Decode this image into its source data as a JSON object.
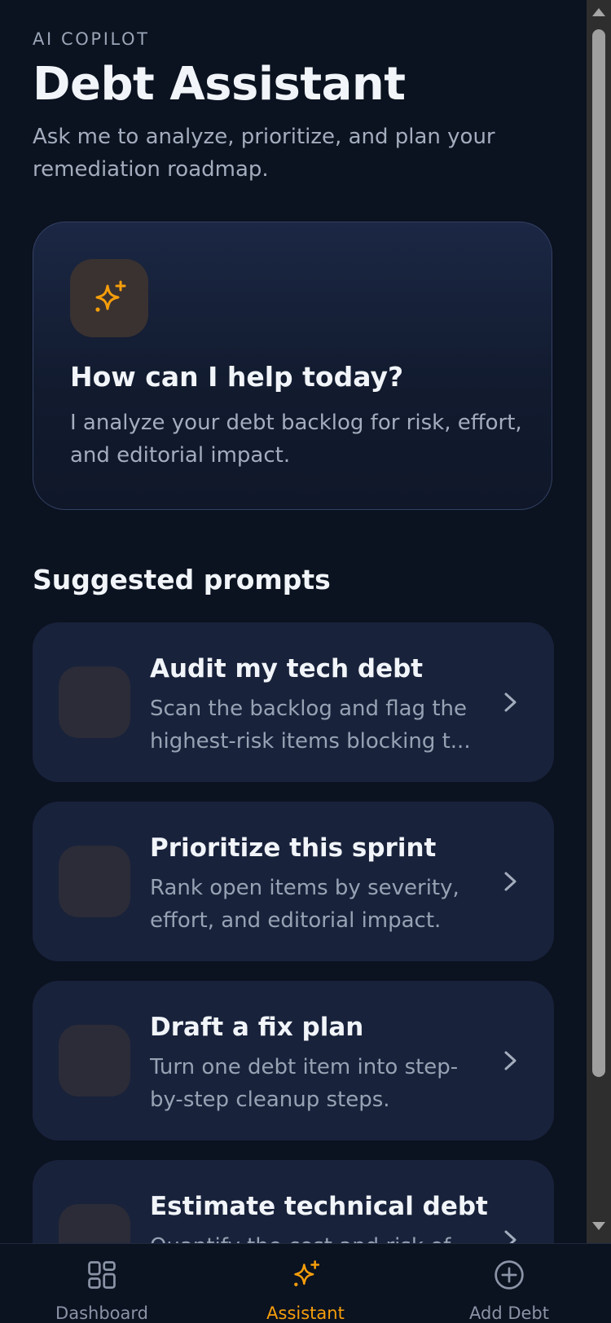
{
  "header": {
    "eyebrow": "AI COPILOT",
    "title": "Debt Assistant",
    "subtitle": "Ask me to analyze, prioritize, and plan your remediation roadmap."
  },
  "help_card": {
    "icon": "sparkles-icon",
    "title": "How can I help today?",
    "description": "I analyze your debt backlog for risk, effort, and editorial impact."
  },
  "suggested": {
    "heading": "Suggested prompts",
    "items": [
      {
        "title": "Audit my tech debt",
        "description": "Scan the backlog and flag the highest-risk items blocking t..."
      },
      {
        "title": "Prioritize this sprint",
        "description": "Rank open items by severity, effort, and editorial impact."
      },
      {
        "title": "Draft a fix plan",
        "description": "Turn one debt item into step-by-step cleanup steps."
      },
      {
        "title": "Estimate technical debt",
        "description": "Quantify the cost and risk of"
      }
    ]
  },
  "tabbar": {
    "items": [
      {
        "label": "Dashboard",
        "icon": "grid-icon",
        "active": false
      },
      {
        "label": "Assistant",
        "icon": "sparkles-icon",
        "active": true
      },
      {
        "label": "Add Debt",
        "icon": "plus-circle-icon",
        "active": false
      }
    ]
  },
  "colors": {
    "background": "#0b1220",
    "card": "#19223b",
    "accent": "#f59e0b",
    "muted_text": "#a3adbd"
  }
}
